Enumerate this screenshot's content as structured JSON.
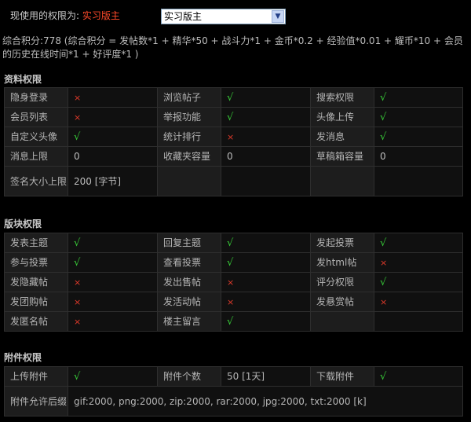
{
  "header": {
    "label": "现使用的权限为:",
    "role": "实习版主",
    "select_value": "实习版主"
  },
  "score": {
    "text": "综合积分:778 (综合积分 = 发帖数*1 + 精华*50 + 战斗力*1 + 金币*0.2 + 经验值*0.01 + 耀币*10 + 会员的历史在线时间*1 + 好评度*1 )"
  },
  "sections": {
    "data": {
      "title": "资料权限",
      "rows": [
        [
          [
            "隐身登录",
            "no"
          ],
          [
            "浏览帖子",
            "yes"
          ],
          [
            "搜索权限",
            "yes"
          ]
        ],
        [
          [
            "会员列表",
            "no"
          ],
          [
            "举报功能",
            "yes"
          ],
          [
            "头像上传",
            "yes"
          ]
        ],
        [
          [
            "自定义头像",
            "yes"
          ],
          [
            "统计排行",
            "no"
          ],
          [
            "发消息",
            "yes"
          ]
        ],
        [
          [
            "消息上限",
            "0"
          ],
          [
            "收藏夹容量",
            "0"
          ],
          [
            "草稿箱容量",
            "0"
          ]
        ],
        [
          [
            "签名大小上限",
            "200 [字节]"
          ],
          [
            "",
            ""
          ],
          [
            "",
            ""
          ]
        ]
      ]
    },
    "board": {
      "title": "版块权限",
      "rows": [
        [
          [
            "发表主题",
            "yes"
          ],
          [
            "回复主题",
            "yes"
          ],
          [
            "发起投票",
            "yes"
          ]
        ],
        [
          [
            "参与投票",
            "yes"
          ],
          [
            "查看投票",
            "yes"
          ],
          [
            "发html帖",
            "no"
          ]
        ],
        [
          [
            "发隐藏帖",
            "no"
          ],
          [
            "发出售帖",
            "no"
          ],
          [
            "评分权限",
            "yes"
          ]
        ],
        [
          [
            "发团购帖",
            "no"
          ],
          [
            "发活动帖",
            "no"
          ],
          [
            "发悬赏帖",
            "no"
          ]
        ],
        [
          [
            "发匿名帖",
            "no"
          ],
          [
            "楼主留言",
            "yes"
          ],
          [
            "",
            ""
          ]
        ]
      ]
    },
    "attach": {
      "title": "附件权限",
      "upload_label": "上传附件",
      "upload_value": "yes",
      "count_label": "附件个数",
      "count_value": "50 [1天]",
      "download_label": "下载附件",
      "download_value": "yes",
      "allowed_label": "附件允许后缀",
      "allowed_value": "gif:2000, png:2000, zip:2000, rar:2000, jpg:2000, txt:2000 [k]"
    }
  },
  "symbols": {
    "yes": "√",
    "no": "×"
  },
  "colors": {
    "yes": "#37c837",
    "no": "#e03a2a",
    "role": "#ff4a2a"
  }
}
